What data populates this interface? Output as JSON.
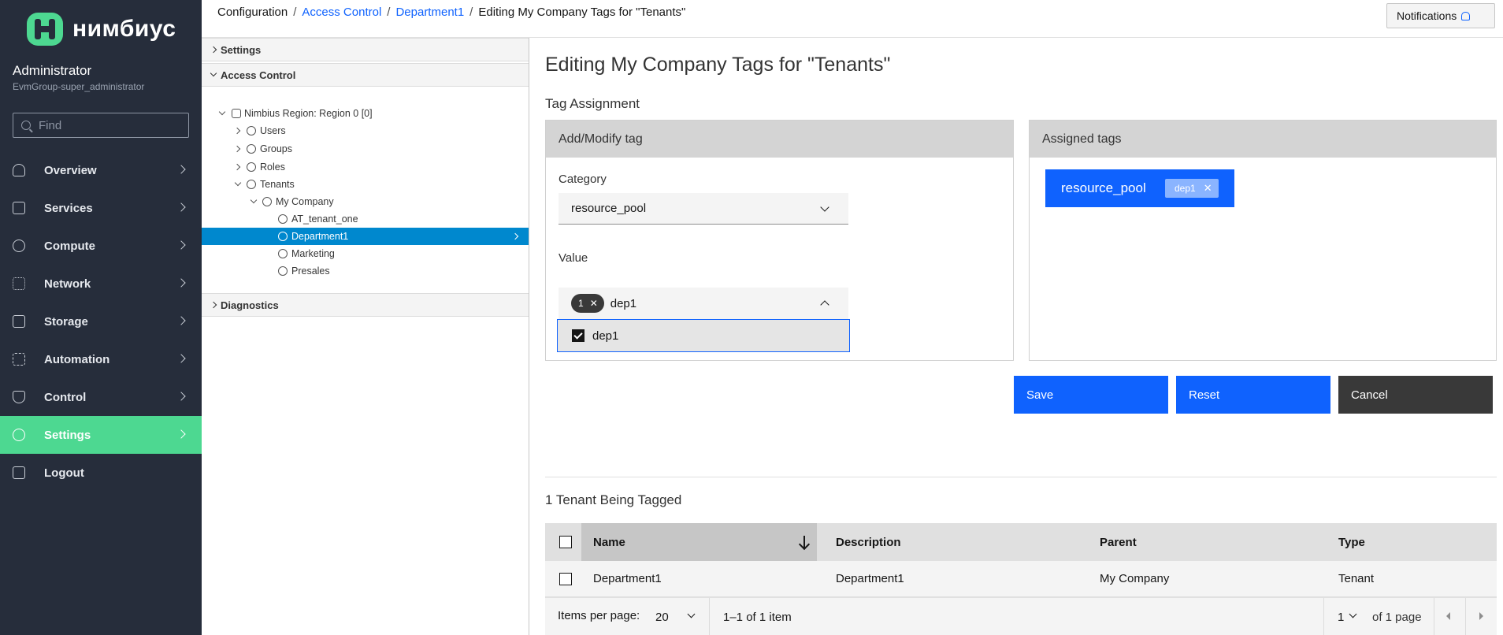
{
  "nav": {
    "logo_text": "нимбиус",
    "user_name": "Administrator",
    "user_group": "EvmGroup-super_administrator",
    "find_placeholder": "Find",
    "items": [
      {
        "label": "Overview",
        "icon": "cloud-icon"
      },
      {
        "label": "Services",
        "icon": "briefcase-icon"
      },
      {
        "label": "Compute",
        "icon": "chip-icon"
      },
      {
        "label": "Network",
        "icon": "network-icon"
      },
      {
        "label": "Storage",
        "icon": "database-icon"
      },
      {
        "label": "Automation",
        "icon": "automation-icon"
      },
      {
        "label": "Control",
        "icon": "shield-icon"
      },
      {
        "label": "Settings",
        "icon": "gear-icon",
        "active": true
      },
      {
        "label": "Logout",
        "icon": "logout-icon"
      }
    ],
    "active_color": "#4dd891"
  },
  "header": {
    "breadcrumb": [
      "Configuration",
      "Access Control",
      "Department1",
      "Editing My Company Tags for \"Tenants\""
    ],
    "notifications_label": "Notifications"
  },
  "tree": {
    "settings_label": "Settings",
    "access_control_label": "Access Control",
    "diagnostics_label": "Diagnostics",
    "nodes": [
      {
        "label": "Nimbius Region: Region 0 [0]",
        "icon": "database-icon"
      },
      {
        "label": "Users",
        "icon": "user-icon"
      },
      {
        "label": "Groups",
        "icon": "users-icon"
      },
      {
        "label": "Roles",
        "icon": "user-icon"
      },
      {
        "label": "Tenants",
        "icon": "tenant-icon"
      },
      {
        "label": "My Company",
        "icon": "tenant-icon"
      },
      {
        "label": "AT_tenant_one",
        "icon": "tenant-icon"
      },
      {
        "label": "Department1",
        "icon": "tenant-icon",
        "selected": true
      },
      {
        "label": "Marketing",
        "icon": "tenant-icon"
      },
      {
        "label": "Presales",
        "icon": "tenant-icon"
      }
    ],
    "selected_color": "#0088ce"
  },
  "main": {
    "title": "Editing My Company Tags for \"Tenants\"",
    "tag_assignment_title": "Tag Assignment",
    "modify_card": {
      "title": "Add/Modify tag",
      "category_label": "Category",
      "category_value": "resource_pool",
      "value_label": "Value",
      "value_selected_count": "1",
      "value_text": "dep1",
      "options": [
        {
          "label": "dep1",
          "checked": true
        }
      ]
    },
    "assigned_card": {
      "title": "Assigned tags",
      "tags": [
        {
          "category": "resource_pool",
          "value": "dep1"
        }
      ]
    },
    "buttons": {
      "save": "Save",
      "reset": "Reset",
      "cancel": "Cancel"
    },
    "primary_color": "#0f62fe",
    "table": {
      "title": "1 Tenant Being Tagged",
      "columns": [
        "Name",
        "Description",
        "Parent",
        "Type"
      ],
      "rows": [
        {
          "name": "Department1",
          "description": "Department1",
          "parent": "My Company",
          "type": "Tenant"
        }
      ]
    },
    "pagination": {
      "items_per_page_label": "Items per page:",
      "items_per_page_value": "20",
      "range_text": "1–1 of 1 item",
      "page_value": "1",
      "of_pages_text": "of 1 page"
    }
  }
}
